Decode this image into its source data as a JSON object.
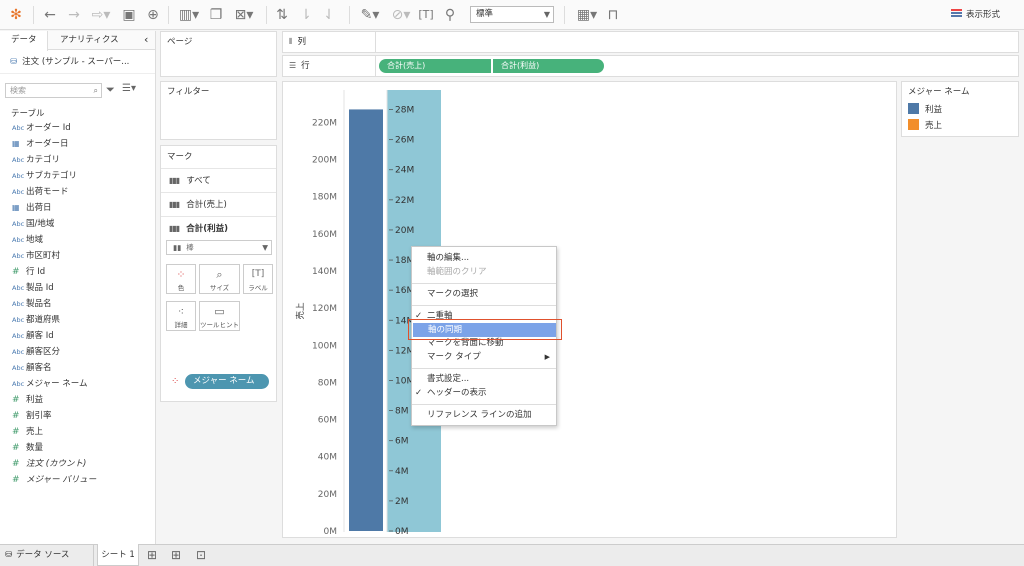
{
  "toolbar": {
    "fit_value": "標準",
    "show_me_label": "表示形式"
  },
  "data_pane": {
    "tab_data": "データ",
    "tab_analytics": "アナリティクス",
    "collapse": "‹",
    "source": "注文 (サンプル - スーパー...",
    "search_placeholder": "検索",
    "section_table": "テーブル",
    "fields": [
      {
        "type": "Abc",
        "name": "オーダー Id"
      },
      {
        "type": "date",
        "name": "オーダー日"
      },
      {
        "type": "Abc",
        "name": "カテゴリ"
      },
      {
        "type": "Abc",
        "name": "サブカテゴリ"
      },
      {
        "type": "Abc",
        "name": "出荷モード"
      },
      {
        "type": "date",
        "name": "出荷日"
      },
      {
        "type": "Abc",
        "name": "国/地域"
      },
      {
        "type": "Abc",
        "name": "地域"
      },
      {
        "type": "Abc",
        "name": "市区町村"
      },
      {
        "type": "#",
        "name": "行 Id"
      },
      {
        "type": "Abc",
        "name": "製品 Id"
      },
      {
        "type": "Abc",
        "name": "製品名"
      },
      {
        "type": "Abc",
        "name": "都道府県"
      },
      {
        "type": "Abc",
        "name": "顧客 Id"
      },
      {
        "type": "Abc",
        "name": "顧客区分"
      },
      {
        "type": "Abc",
        "name": "顧客名"
      },
      {
        "type": "Abc",
        "name": "メジャー ネーム"
      },
      {
        "type": "#",
        "name": "利益"
      },
      {
        "type": "#",
        "name": "割引率"
      },
      {
        "type": "#",
        "name": "売上"
      },
      {
        "type": "#",
        "name": "数量"
      },
      {
        "type": "#",
        "name": "注文 (カウント)"
      },
      {
        "type": "#",
        "name": "メジャー バリュー"
      }
    ]
  },
  "cards": {
    "pages": "ページ",
    "filters": "フィルター",
    "marks": "マーク",
    "mark_all": "すべて",
    "mark_sales": "合計(売上)",
    "mark_profit": "合計(利益)",
    "mark_type": "棒",
    "btn_color": "色",
    "btn_size": "サイズ",
    "btn_label": "ラベル",
    "btn_detail": "詳細",
    "btn_tooltip": "ツールヒント",
    "color_pill": "メジャー ネーム"
  },
  "shelves": {
    "columns": "列",
    "rows": "行",
    "pill_sales": "合計(売上)",
    "pill_profit": "合計(利益)"
  },
  "chart_data": {
    "type": "bar",
    "categories": [
      ""
    ],
    "series": [
      {
        "name": "売上",
        "values": [
          227
        ]
      },
      {
        "name": "利益",
        "values": [
          29
        ]
      }
    ],
    "ylabel": "売上",
    "left_axis": {
      "unit": "M",
      "ticks": [
        "0M",
        "20M",
        "40M",
        "60M",
        "80M",
        "100M",
        "120M",
        "140M",
        "160M",
        "180M",
        "200M",
        "220M"
      ],
      "ylim": [
        0,
        240
      ]
    },
    "right_axis": {
      "unit": "M",
      "ticks": [
        "0M",
        "2M",
        "4M",
        "6M",
        "8M",
        "10M",
        "12M",
        "14M",
        "16M",
        "18M",
        "20M",
        "22M",
        "24M",
        "26M",
        "28M"
      ],
      "ylim": [
        0,
        29
      ]
    },
    "colors": {
      "sales": "#4e79a7",
      "profit_highlight": "#8fc7d6"
    }
  },
  "legend": {
    "title": "メジャー ネーム",
    "items": [
      {
        "label": "利益",
        "color": "#4e79a7"
      },
      {
        "label": "売上",
        "color": "#f28e2b"
      }
    ]
  },
  "context_menu": {
    "items": [
      {
        "label": "軸の編集...",
        "disabled": false
      },
      {
        "label": "軸範囲のクリア",
        "disabled": true
      },
      {
        "label": "マークの選択",
        "disabled": false
      },
      {
        "label": "二重軸",
        "checked": true
      },
      {
        "label": "軸の同期",
        "highlighted": true
      },
      {
        "label": "マークを背面に移動"
      },
      {
        "label": "マーク タイプ",
        "submenu": "▶"
      },
      {
        "label": "書式設定..."
      },
      {
        "label": "ヘッダーの表示",
        "checked": true
      },
      {
        "label": "リファレンス ラインの追加"
      }
    ]
  },
  "status": {
    "data_source": "データ ソース",
    "sheet": "シート 1"
  }
}
